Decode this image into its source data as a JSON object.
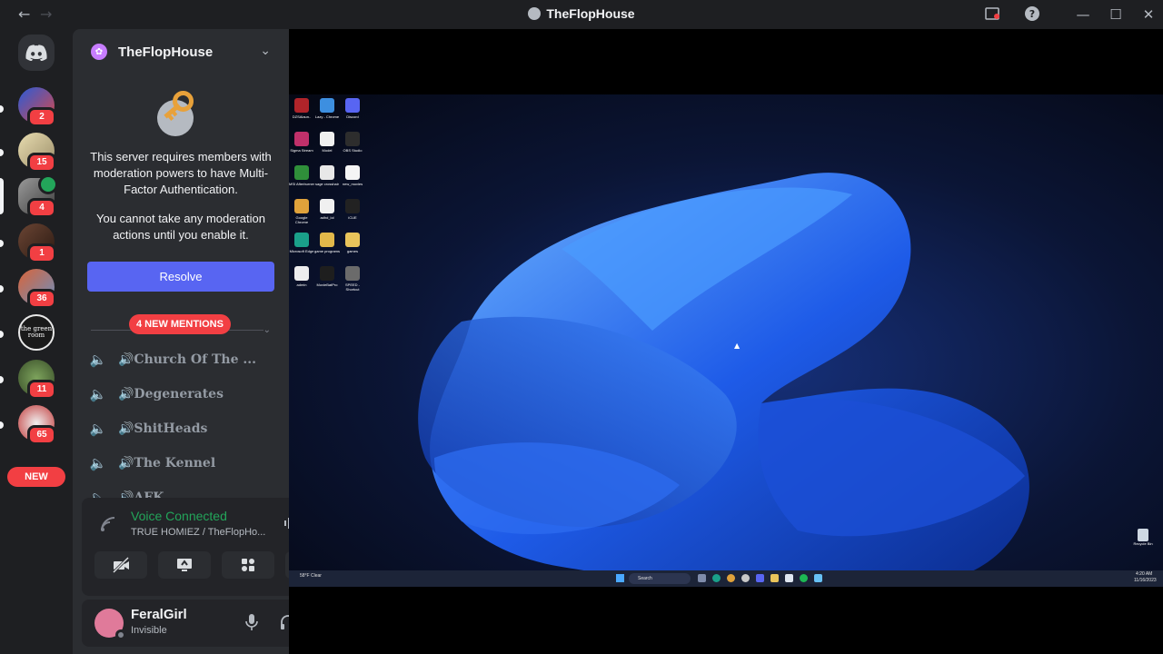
{
  "window": {
    "title": "TheFlopHouse",
    "back_icon": "arrow-left-icon",
    "forward_icon": "arrow-right-icon"
  },
  "rail": {
    "home_icon": "discord-logo-icon",
    "guilds": [
      {
        "name": "server-1",
        "badge": "2",
        "color": "#3a5bd9"
      },
      {
        "name": "server-2",
        "badge": "15",
        "color": "#c9b98a"
      },
      {
        "name": "server-3",
        "badge": "4",
        "color": "#7a7a7a"
      },
      {
        "name": "server-4",
        "badge": "1",
        "color": "#5a3b2e"
      },
      {
        "name": "server-5",
        "badge": "36",
        "color": "#b7452e"
      },
      {
        "name": "the green room",
        "badge": "",
        "color": "#2a2a2a"
      },
      {
        "name": "server-7",
        "badge": "11",
        "color": "#4d6b3a"
      },
      {
        "name": "server-8",
        "badge": "65",
        "color": "#d9d9d9"
      }
    ],
    "new_label": "NEW"
  },
  "sidebar": {
    "server_name": "TheFlopHouse",
    "mfa_text_1": "This server requires members with moderation powers to have Multi-Factor Authentication.",
    "mfa_text_2": "You cannot take any moderation actions until you enable it.",
    "resolve_label": "Resolve",
    "mentions_label": "4 NEW MENTIONS",
    "channels": [
      {
        "label": "🔊Church Of The ..."
      },
      {
        "label": "🔊Degenerates"
      },
      {
        "label": "🔊ShitHeads"
      },
      {
        "label": "🔊The Kennel"
      },
      {
        "label": "🔊AFK"
      }
    ]
  },
  "voice": {
    "status": "Voice Connected",
    "location": "TRUE HOMIEZ / TheFlopHo..."
  },
  "user": {
    "name": "FeralGirl",
    "status": "Invisible"
  },
  "stream": {
    "desktop_icons": [
      {
        "cap": "DZSAlaun..",
        "color": "#b0242a"
      },
      {
        "cap": "Lazy - Chrome",
        "color": "#3d8fe0"
      },
      {
        "cap": "Discord",
        "color": "#5865f2"
      },
      {
        "cap": "Sigma Stream",
        "color": "#c0306a"
      },
      {
        "cap": "Model",
        "color": "#f0f0f0"
      },
      {
        "cap": "OBS Studio",
        "color": "#2d2d2d"
      },
      {
        "cap": "MSI Afterburner",
        "color": "#2f8f3a"
      },
      {
        "cap": "sage crosshair",
        "color": "#e8e8e8"
      },
      {
        "cap": "new_movies",
        "color": "#f5f5f5"
      },
      {
        "cap": "Google Chrome",
        "color": "#e0a23b"
      },
      {
        "cap": "adhd_lol",
        "color": "#f0f0f0"
      },
      {
        "cap": "iCUE",
        "color": "#222222"
      },
      {
        "cap": "Microsoft Edge",
        "color": "#1aa08a"
      },
      {
        "cap": "game programs",
        "color": "#e2b84a"
      },
      {
        "cap": "games",
        "color": "#e9c45b"
      },
      {
        "cap": "admin",
        "color": "#ededed"
      },
      {
        "cap": "MovieBatPro",
        "color": "#1e1e1e"
      },
      {
        "cap": "SPEED - Shortcut",
        "color": "#6b6b6b"
      }
    ],
    "recycle_label": "Recycle Bin",
    "time": "4:20 AM",
    "date": "11/16/2023",
    "weather": "58°F Clear",
    "search_label": "Search"
  }
}
